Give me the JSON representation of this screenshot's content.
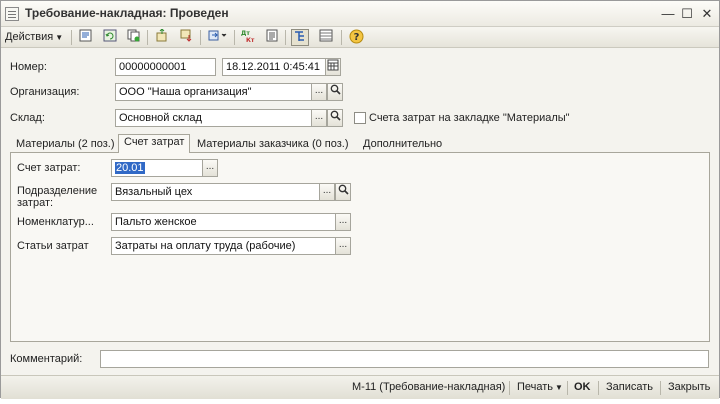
{
  "window": {
    "title": "Требование-накладная: Проведен"
  },
  "window_controls": {
    "minimize": "—",
    "maximize": "☐",
    "close": "✕"
  },
  "toolbar": {
    "actions_label": "Действия",
    "help_glyph": "?"
  },
  "form": {
    "nomer_label": "Номер:",
    "nomer_value": "00000000001",
    "date_value": "18.12.2011  0:45:41",
    "org_label": "Организация:",
    "org_value": "ООО \"Наша организация\"",
    "sklad_label": "Склад:",
    "sklad_value": "Основной склад",
    "checkbox_label": "Счета затрат на закладке \"Материалы\""
  },
  "tabs": [
    {
      "label": "Материалы (2 поз.)"
    },
    {
      "label": "Счет затрат"
    },
    {
      "label": "Материалы заказчика (0 поз.)"
    },
    {
      "label": "Дополнительно"
    }
  ],
  "tab_panel": {
    "account_label": "Счет затрат:",
    "account_value": "20.01",
    "division_label_1": "Подразделение",
    "division_label_2": "затрат:",
    "division_value": "Вязальный цех",
    "nomenclature_label": "Номенклатур...",
    "nomenclature_value": "Пальто женское",
    "cost_items_label": "Статьи затрат",
    "cost_items_value": "Затраты на оплату труда (рабочие)"
  },
  "comment": {
    "label": "Комментарий:",
    "value": ""
  },
  "statusbar": {
    "form_name": "М-11 (Требование-накладная)",
    "print_label": "Печать",
    "ok_label": "OK",
    "save_label": "Записать",
    "close_label": "Закрыть"
  }
}
